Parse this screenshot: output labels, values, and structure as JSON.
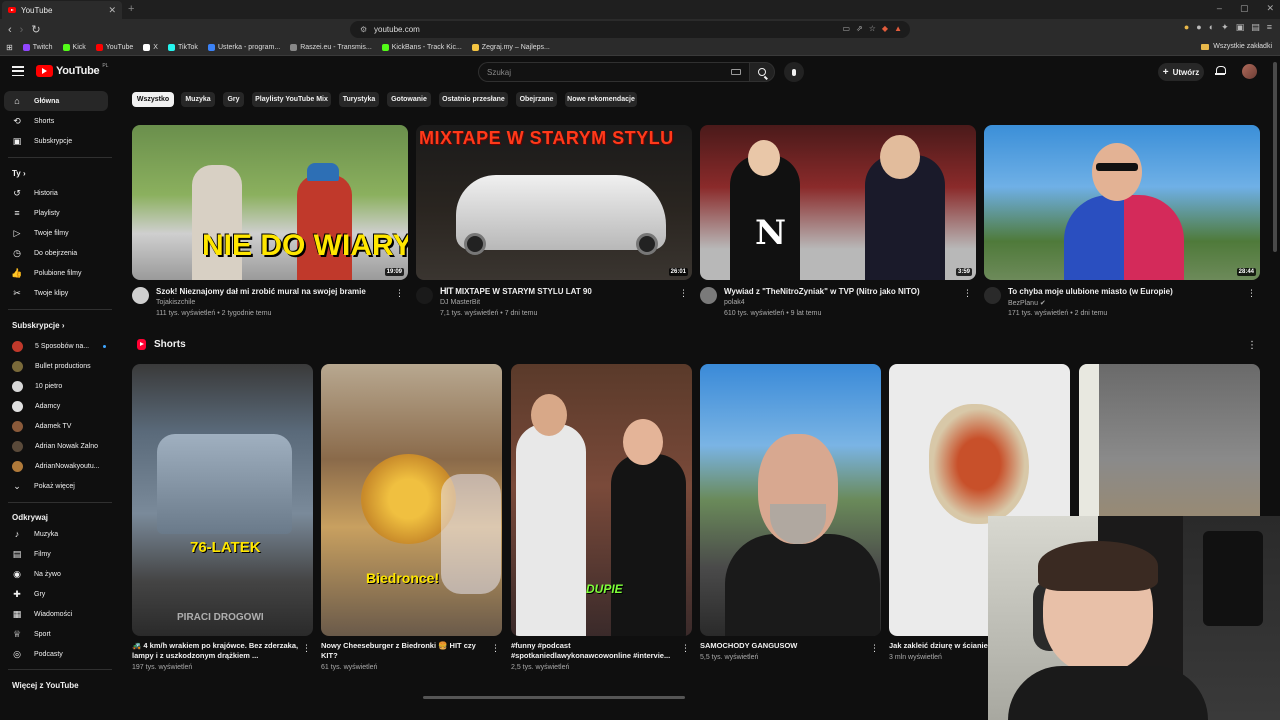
{
  "browser": {
    "tab_title": "YouTube",
    "url": "youtube.com",
    "bookmarks": [
      {
        "label": "Twitch",
        "color": "#9146ff"
      },
      {
        "label": "Kick",
        "color": "#53fc18"
      },
      {
        "label": "YouTube",
        "color": "#ff0000"
      },
      {
        "label": "X",
        "color": "#ffffff"
      },
      {
        "label": "TikTok",
        "color": "#25f4ee"
      },
      {
        "label": "Usterka - program...",
        "color": "#3b82f6"
      },
      {
        "label": "Raszei.eu - Transmis...",
        "color": "#888888"
      },
      {
        "label": "KickBans - Track Kic...",
        "color": "#53fc18"
      },
      {
        "label": "Zegraj.my – Najleps...",
        "color": "#f5c542"
      }
    ],
    "bookmarks_folder": "Wszystkie zakładki"
  },
  "header": {
    "logo": "YouTube",
    "logo_country": "PL",
    "search_placeholder": "Szukaj",
    "create_label": "Utwórz"
  },
  "sidebar": {
    "main": [
      {
        "label": "Główna",
        "icon": "home-icon"
      },
      {
        "label": "Shorts",
        "icon": "shorts-icon"
      },
      {
        "label": "Subskrypcje",
        "icon": "subscriptions-icon"
      }
    ],
    "you_heading": "Ty",
    "you": [
      {
        "label": "Historia",
        "icon": "history-icon"
      },
      {
        "label": "Playlisty",
        "icon": "playlists-icon"
      },
      {
        "label": "Twoje filmy",
        "icon": "your-videos-icon"
      },
      {
        "label": "Do obejrzenia",
        "icon": "watch-later-icon"
      },
      {
        "label": "Polubione filmy",
        "icon": "liked-icon"
      },
      {
        "label": "Twoje klipy",
        "icon": "clips-icon"
      }
    ],
    "subs_heading": "Subskrypcje",
    "subs": [
      {
        "label": "5 Sposobów na...",
        "color": "#c0392b"
      },
      {
        "label": "Bullet productions",
        "color": "#7a6a3a"
      },
      {
        "label": "10 pietro",
        "color": "#d8d8d8"
      },
      {
        "label": "Adamcy",
        "color": "#e0e0e0"
      },
      {
        "label": "Adamek TV",
        "color": "#8a5a3a"
      },
      {
        "label": "Adrian Nowak Zalno",
        "color": "#5a4a3a"
      },
      {
        "label": "AdrianNowakyoutu...",
        "color": "#b07a3a"
      }
    ],
    "show_more": "Pokaż więcej",
    "explore_heading": "Odkrywaj",
    "explore": [
      {
        "label": "Muzyka",
        "icon": "music-icon"
      },
      {
        "label": "Filmy",
        "icon": "movies-icon"
      },
      {
        "label": "Na żywo",
        "icon": "live-icon"
      },
      {
        "label": "Gry",
        "icon": "gaming-icon"
      },
      {
        "label": "Wiadomości",
        "icon": "news-icon"
      },
      {
        "label": "Sport",
        "icon": "sport-icon"
      },
      {
        "label": "Podcasty",
        "icon": "podcasts-icon"
      }
    ],
    "more_heading": "Więcej z YouTube"
  },
  "chips": [
    "Wszystko",
    "Muzyka",
    "Gry",
    "Playlisty YouTube Mix",
    "Turystyka",
    "Gotowanie",
    "Ostatnio przesłane",
    "Obejrzane",
    "Nowe rekomendacje"
  ],
  "videos": [
    {
      "title": "Szok! Nieznajomy dał mi zrobić mural na swojej bramie",
      "channel": "Tojakiszchile",
      "stats": "111 tys. wyświetleń • 2 tygodnie temu",
      "duration": "19:09",
      "caption": "NIE DO WIARY!"
    },
    {
      "title": "MIXTAPE W STARYM STYLU LAT 90",
      "channel": "DJ MasterBit",
      "stats": "7,1 tys. wyświetleń • 7 dni temu",
      "duration": "26:01",
      "caption": "MIXTAPE W STARYM STYLU",
      "channel_badge": "HIT"
    },
    {
      "title": "Wywiad z \"TheNitroZyniak\" w TVP (Nitro jako NITO)",
      "channel": "polak4",
      "stats": "610 tys. wyświetleń • 9 lat temu",
      "duration": "3:59",
      "caption": "N"
    },
    {
      "title": "To chyba moje ulubione miasto (w Europie)",
      "channel": "BezPlanu",
      "stats": "171 tys. wyświetleń • 2 dni temu",
      "duration": "28:44",
      "caption": ""
    }
  ],
  "shorts_heading": "Shorts",
  "shorts": [
    {
      "title": "🚜 4 km/h wrakiem po krajówce. Bez zderzaka, lampy i z uszkodzonym drążkiem ...",
      "views": "197 tys. wyświetleń",
      "caption": "76-LATEK",
      "watermark": "PIRACI DROGOWI"
    },
    {
      "title": "Nowy Cheeseburger z Biedronki 🍔 HIT czy KIT?",
      "views": "61 tys. wyświetleń",
      "caption": "Biedronce!"
    },
    {
      "title": "#funny #podcast #spotkaniedlawykonawcowonline #intervie...",
      "views": "2,5 tys. wyświetleń",
      "caption": "DUPIE"
    },
    {
      "title": "SAMOCHODY GANGUSOW",
      "views": "5,5 tys. wyświetleń",
      "caption": ""
    },
    {
      "title": "Jak zakleić dziurę w ścianie",
      "views": "3 mln wyświetleń",
      "caption": ""
    },
    {
      "title": "",
      "views": "",
      "caption": ""
    }
  ]
}
